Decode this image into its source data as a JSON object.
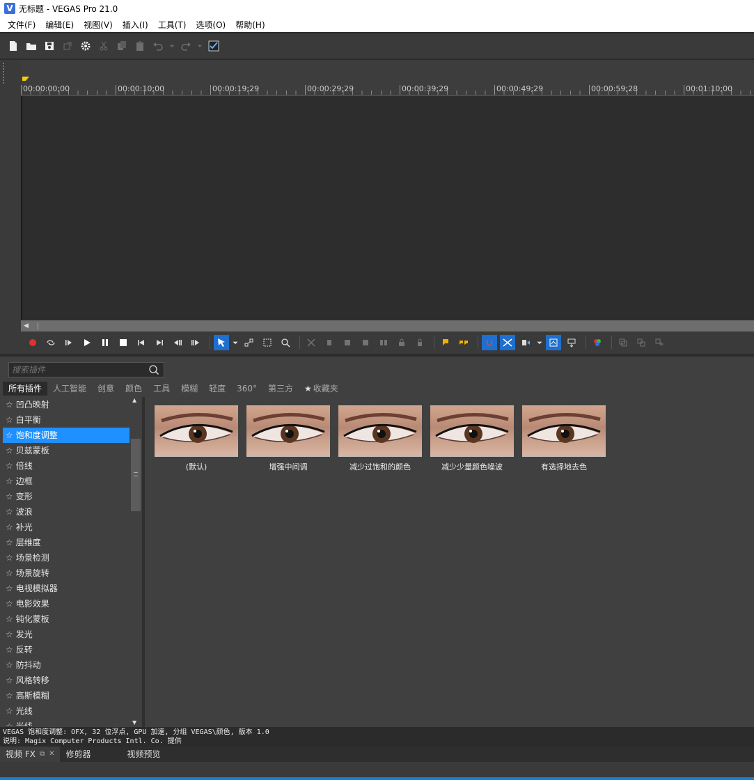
{
  "window": {
    "title": "无标题 - VEGAS Pro 21.0",
    "logo_letter": "V"
  },
  "menu": [
    "文件(F)",
    "编辑(E)",
    "视图(V)",
    "插入(I)",
    "工具(T)",
    "选项(O)",
    "帮助(H)"
  ],
  "ruler": {
    "ticks": [
      "00:00:00;00",
      "00:00:10;00",
      "00:00:19;29",
      "00:00:29;29",
      "00:00:39;29",
      "00:00:49;29",
      "00:00:59;28",
      "00:01:10;00"
    ]
  },
  "plugins": {
    "search_placeholder": "搜索插件",
    "tabs": [
      "所有插件",
      "人工智能",
      "创意",
      "颜色",
      "工具",
      "模糊",
      "轻度",
      "360°",
      "第三方",
      "收藏夹"
    ],
    "items": [
      "凹凸映射",
      "白平衡",
      "饱和度调整",
      "贝兹蒙板",
      "倍线",
      "边框",
      "变形",
      "波浪",
      "补光",
      "层维度",
      "场景检测",
      "场景旋转",
      "电视模拟器",
      "电影效果",
      "钝化蒙板",
      "发光",
      "反转",
      "防抖动",
      "风格转移",
      "高斯模糊",
      "光线",
      "光线"
    ],
    "selected_index": 2,
    "presets": [
      "(默认)",
      "增强中间调",
      "减少过饱和的颜色",
      "减少少量颜色噪波",
      "有选择地去色"
    ]
  },
  "status": {
    "line1": "VEGAS 饱和度调整: OFX, 32 位浮点, GPU 加速, 分组 VEGAS\\颜色, 版本 1.0",
    "line2": "说明: Magix Computer Products Intl. Co. 提供"
  },
  "bottom_tabs": [
    "视频 FX",
    "修剪器",
    "视频预览"
  ],
  "colors": {
    "accent": "#1e90ff",
    "marker": "#f5d000",
    "panel": "#404040"
  }
}
